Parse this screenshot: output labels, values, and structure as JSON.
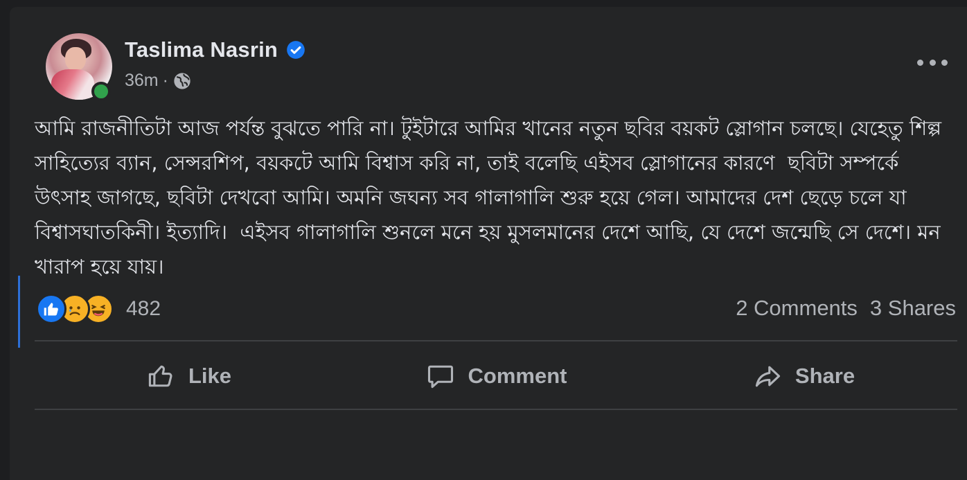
{
  "post": {
    "author": "Taslima Nasrin",
    "verified": true,
    "time": "36m",
    "separator": "·",
    "audience_icon": "globe-icon",
    "more_icon": "more-options-icon",
    "text": "আমি রাজনীতিটা আজ পর্যন্ত বুঝতে পারি না। টুইটারে আমির খানের নতুন ছবির বয়কট স্লোগান চলছে। যেহেতু শিল্প সাহিত্যের ব্যান, সেন্সরশিপ, বয়কটে আমি বিশ্বাস করি না, তাই বলেছি এইসব স্লোগানের কারণে  ছবিটা সম্পর্কে উৎসাহ জাগছে, ছবিটা দেখবো আমি। অমনি জঘন্য সব গালাগালি শুরু হয়ে গেল। আমাদের দেশ ছেড়ে চলে যা বিশ্বাসঘাতকিনী। ইত্যাদি।  এইসব গালাগালি শুনলে মনে হয় মুসলমানের দেশে আছি, যে দেশে জন্মেছি সে দেশে। মন খারাপ হয়ে যায়।"
  },
  "reactions": {
    "icons": [
      "like-reaction-icon",
      "sad-reaction-icon",
      "haha-reaction-icon"
    ],
    "count": "482"
  },
  "stats": {
    "comments": "2 Comments",
    "shares": "3 Shares"
  },
  "actions": {
    "like": "Like",
    "comment": "Comment",
    "share": "Share"
  },
  "colors": {
    "background": "#242526",
    "text_primary": "#e4e6eb",
    "text_secondary": "#b0b3b8",
    "verified": "#1877f2",
    "online": "#31a24c"
  }
}
